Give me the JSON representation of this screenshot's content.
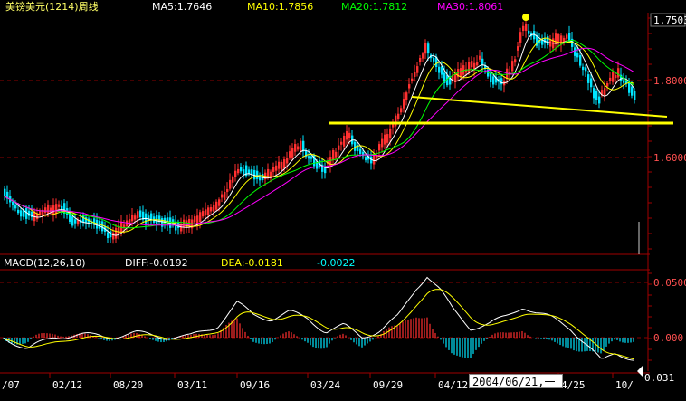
{
  "header": {
    "title": "美镑美元(1214)周线",
    "ma": [
      {
        "label": "MA5:1.7646",
        "color": "#ffffff"
      },
      {
        "label": "MA10:1.7856",
        "color": "#ffff00"
      },
      {
        "label": "MA20:1.7812",
        "color": "#00ff00"
      },
      {
        "label": "MA30:1.8061",
        "color": "#ff00ff"
      }
    ]
  },
  "price_axis": {
    "labels": [
      "1.7503",
      "1.8000",
      "1.6000"
    ]
  },
  "macd_header": {
    "name": "MACD(12,26,10)",
    "diff": "DIFF:-0.0192",
    "dea": "DEA:-0.0181",
    "macd": "-0.0022"
  },
  "macd_axis": {
    "labels": [
      "0.0500",
      "0.000"
    ]
  },
  "date_labels": [
    "/07",
    "02/12",
    "08/20",
    "03/11",
    "09/16",
    "03/24",
    "09/29",
    "04/12",
    "4/25",
    "10/"
  ],
  "cursor_date": "2004/06/21,一",
  "corner_value": "0.031",
  "colors": {
    "up": "#ff3030",
    "down": "#00e5ff",
    "grid": "#8b0000",
    "trend": "#ffff00"
  },
  "chart_data": [
    {
      "type": "candlestick",
      "title": "美镑美元(1214)周线",
      "ylim": [
        1.5,
        1.97
      ],
      "ticks": [
        1.6,
        1.8
      ],
      "trend_lines": [
        {
          "from": [
            34,
            1.705
          ],
          "to": [
            93,
            1.705
          ]
        },
        {
          "from": [
            46,
            1.77
          ],
          "to": [
            92,
            1.72
          ]
        }
      ],
      "ma_lines": [
        "MA5",
        "MA10",
        "MA20",
        "MA30"
      ]
    },
    {
      "type": "bar",
      "title": "MACD(12,26,10)",
      "ylim": [
        -0.085,
        0.085
      ],
      "ticks": [
        0.0,
        0.05
      ],
      "series": [
        "DIFF",
        "DEA",
        "MACD"
      ]
    }
  ]
}
